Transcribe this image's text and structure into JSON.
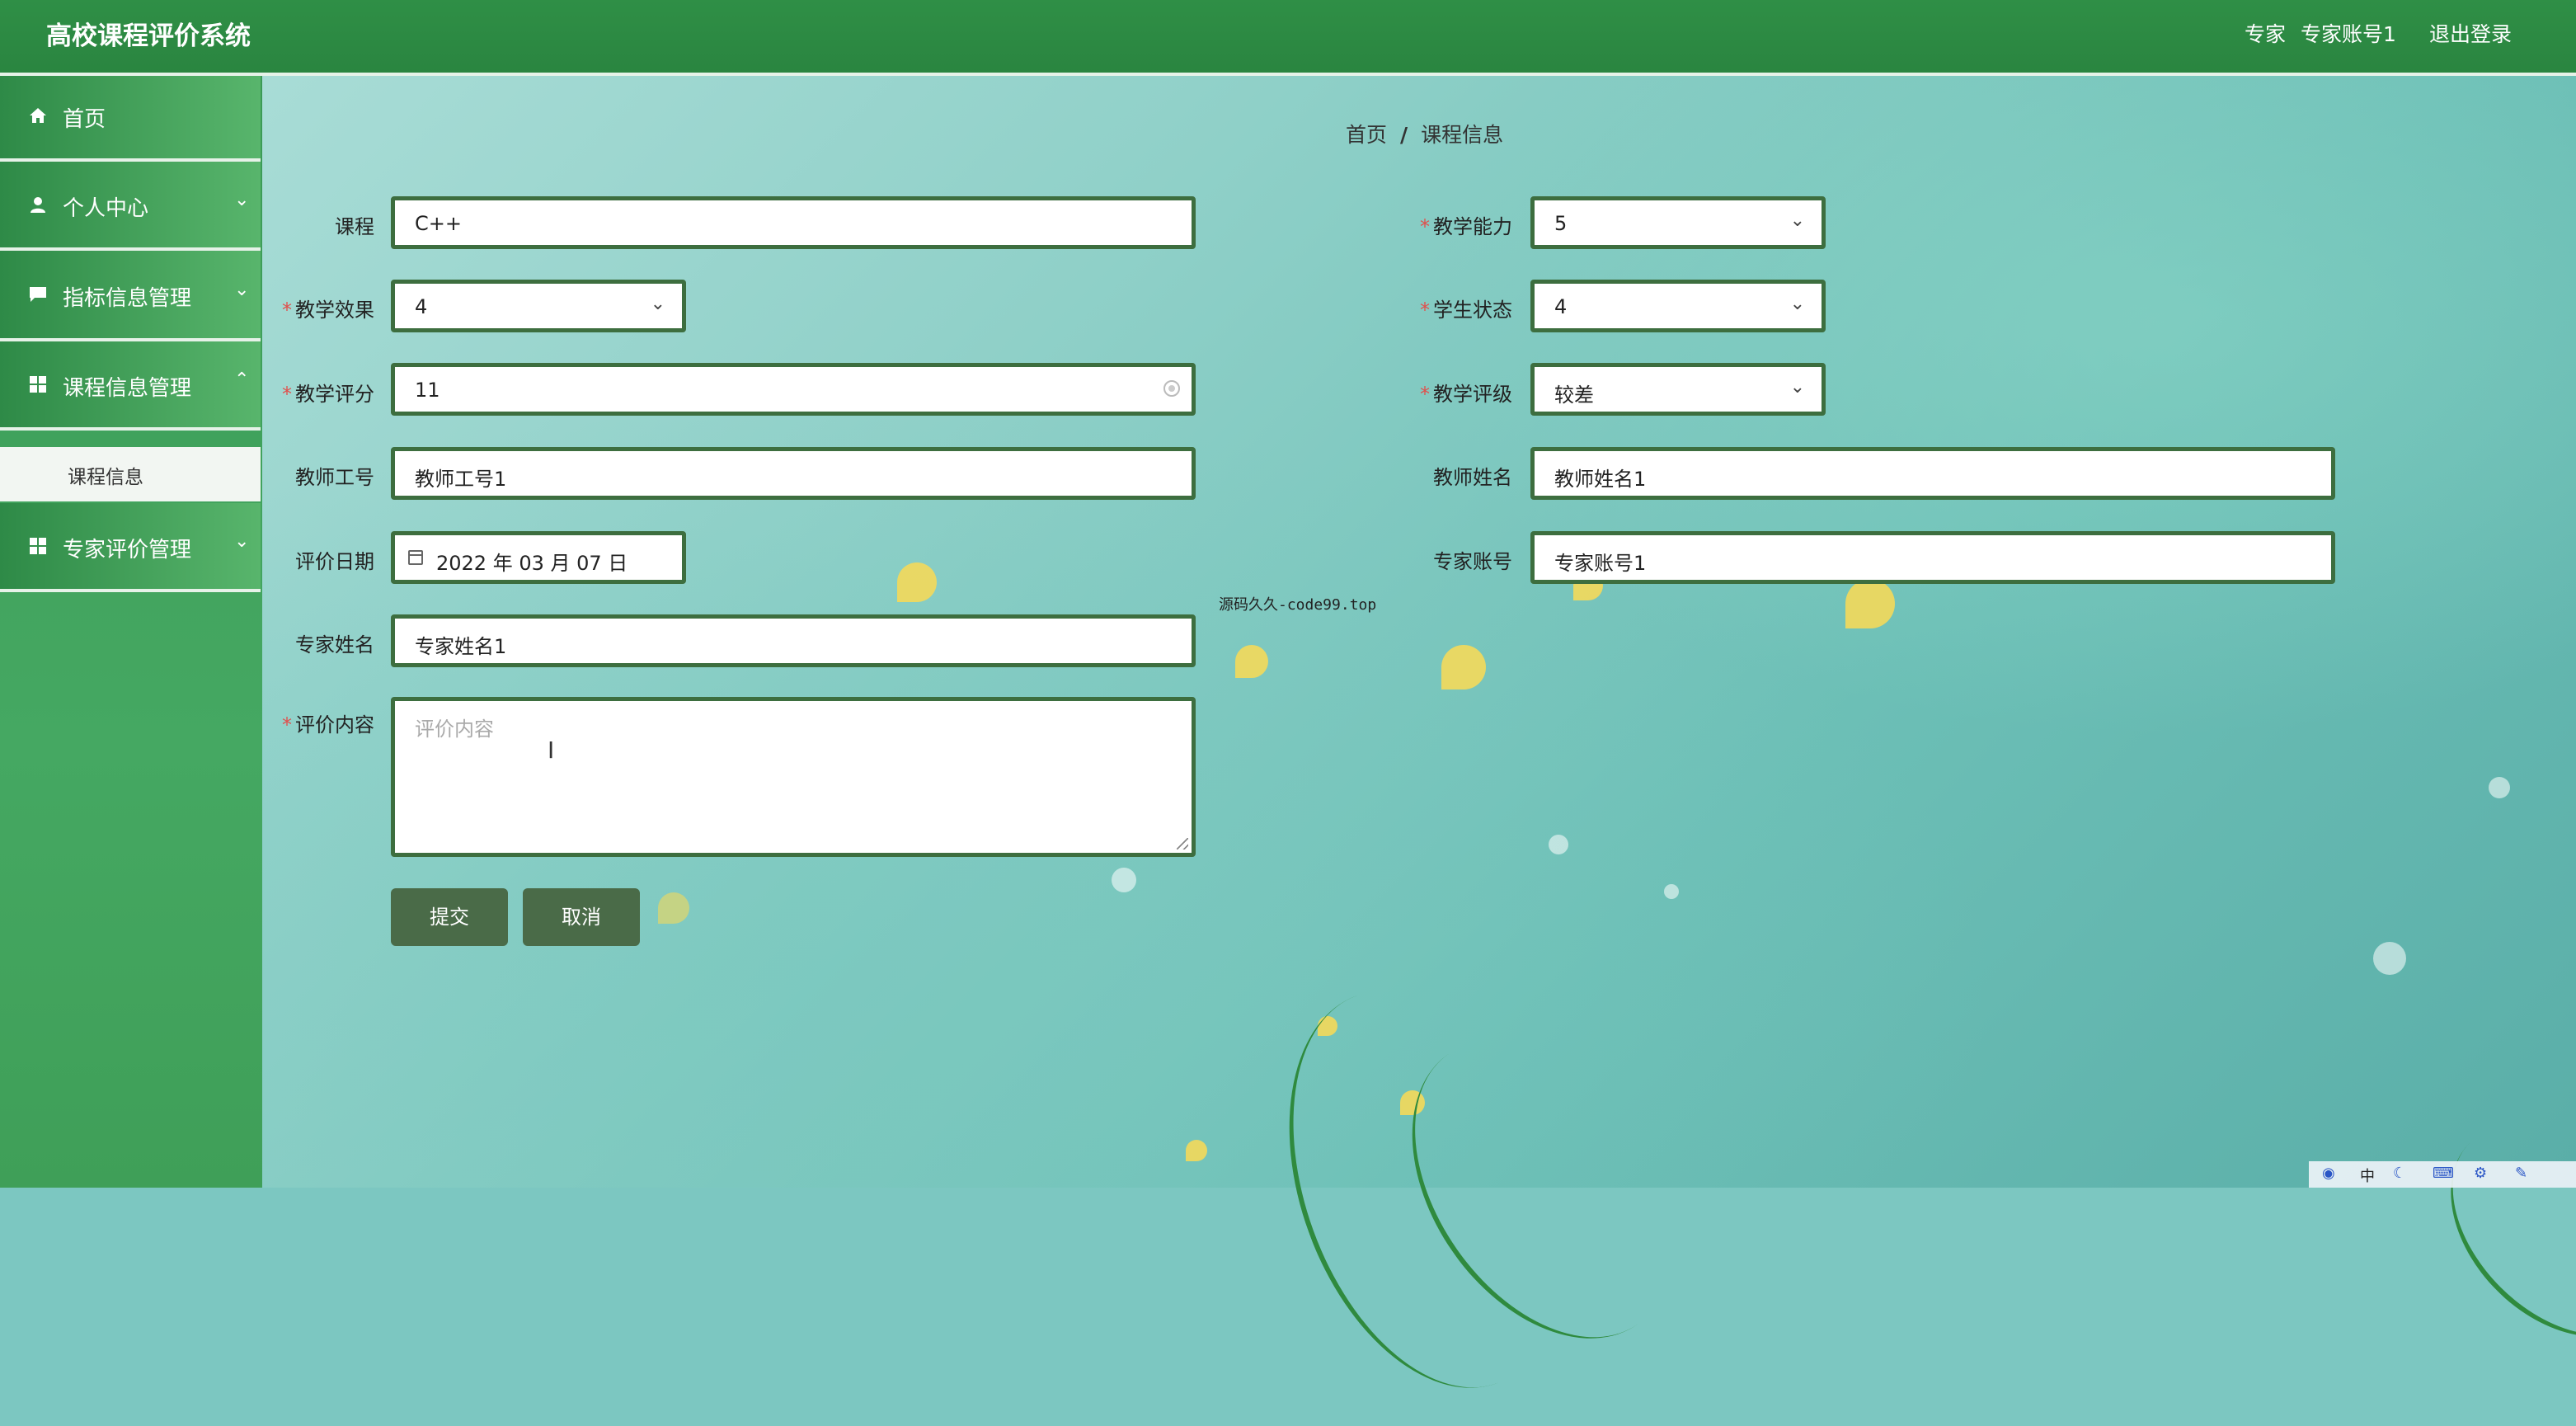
{
  "header": {
    "app_title": "高校课程评价系统",
    "user_role": "专家",
    "user_name": "专家账号1",
    "logout": "退出登录"
  },
  "sidebar": {
    "items": [
      {
        "label": "首页",
        "icon": "home-icon"
      },
      {
        "label": "个人中心",
        "icon": "user-icon"
      },
      {
        "label": "指标信息管理",
        "icon": "message-icon"
      },
      {
        "label": "课程信息管理",
        "icon": "grid-icon"
      },
      {
        "label": "专家评价管理",
        "icon": "grid-icon"
      }
    ],
    "sub_item": "课程信息"
  },
  "breadcrumb": {
    "home": "首页",
    "separator": "/",
    "current": "课程信息"
  },
  "form": {
    "course": {
      "label": "课程",
      "value": "C++"
    },
    "teaching_ability": {
      "label": "教学能力",
      "value": "5"
    },
    "teaching_effect": {
      "label": "教学效果",
      "value": "4"
    },
    "student_state": {
      "label": "学生状态",
      "value": "4"
    },
    "teaching_score": {
      "label": "教学评分",
      "value": "11"
    },
    "teaching_grade": {
      "label": "教学评级",
      "value": "较差"
    },
    "teacher_id": {
      "label": "教师工号",
      "value": "教师工号1"
    },
    "teacher_name": {
      "label": "教师姓名",
      "value": "教师姓名1"
    },
    "eval_date": {
      "label": "评价日期",
      "value": "2022 年 03 月 07 日"
    },
    "expert_account": {
      "label": "专家账号",
      "value": "专家账号1"
    },
    "expert_name": {
      "label": "专家姓名",
      "value": "专家姓名1"
    },
    "eval_content": {
      "label": "评价内容",
      "placeholder": "评价内容"
    },
    "required_mark": "*",
    "submit": "提交",
    "cancel": "取消"
  },
  "source_note": "源码久久-code99.top",
  "tray": {
    "ime": "中"
  },
  "colors": {
    "header_green": "#2f8f46",
    "field_border": "#3d6e3f",
    "button_bg": "#4a6b48",
    "required": "#e0504d"
  }
}
